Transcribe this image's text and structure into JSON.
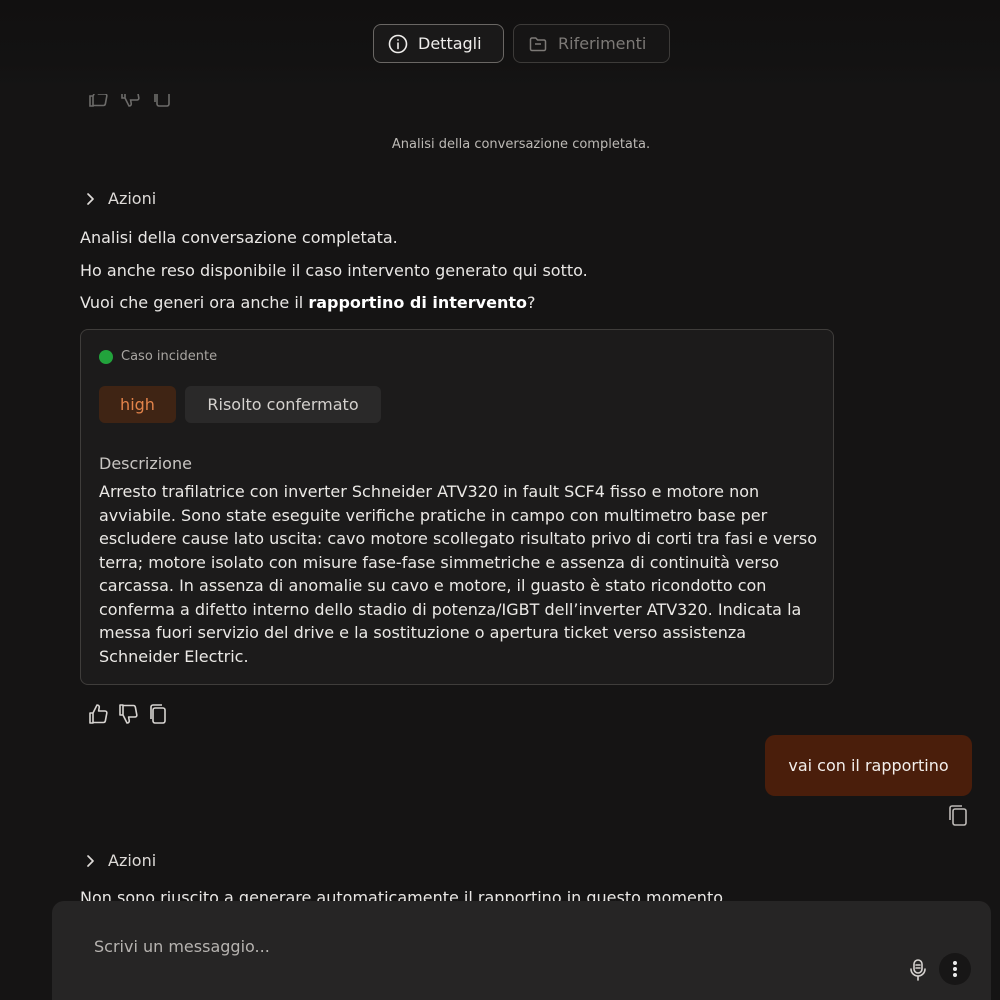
{
  "header": {
    "tabs": [
      {
        "label": "Dettagli",
        "icon": "info-icon",
        "active": true
      },
      {
        "label": "Riferimenti",
        "icon": "folder-icon",
        "active": false
      }
    ]
  },
  "chat": {
    "system_note": "Analisi della conversazione completata.",
    "actions_label": "Azioni",
    "assistant_message": {
      "line1": "Analisi della conversazione completata.",
      "line2": "Ho anche reso disponibile il caso intervento generato qui sotto.",
      "line3_prefix": "Vuoi che generi ora anche il ",
      "line3_bold": "rapportino di intervento",
      "line3_suffix": "?"
    },
    "case_card": {
      "title": "Caso incidente",
      "status_dot_color": "#22a33c",
      "severity": "high",
      "status": "Risolto confermato",
      "description_label": "Descrizione",
      "description": "Arresto trafilatrice con inverter Schneider ATV320 in fault SCF4 fisso e motore non avviabile. Sono state eseguite verifiche pratiche in campo con multimetro base per escludere cause lato uscita: cavo motore scollegato risultato privo di corti tra fasi e verso terra; motore isolato con misure fase-fase simmetriche e assenza di continuità verso carcassa. In assenza di anomalie su cavo e motore, il guasto è stato ricondotto con conferma a difetto interno dello stadio di potenza/IGBT dell’inverter ATV320. Indicata la messa fuori servizio del drive e la sostituzione o apertura ticket verso assistenza Schneider Electric."
    },
    "feedback_icons": [
      "thumbs-up-icon",
      "thumbs-down-icon",
      "copy-icon"
    ],
    "user_message": "vai con il rapportino",
    "second_actions_label": "Azioni",
    "partial_reply": "Non sono riuscito a generare automaticamente il rapportino in questo momento."
  },
  "composer": {
    "placeholder": "Scrivi un messaggio...",
    "mic_icon": "microphone-icon",
    "more_icon": "more-vertical-icon"
  },
  "colors": {
    "background": "#151414",
    "accent_bubble": "#4a1e0b",
    "severity_high_bg": "#3f2414",
    "severity_high_text": "#e3834a"
  }
}
